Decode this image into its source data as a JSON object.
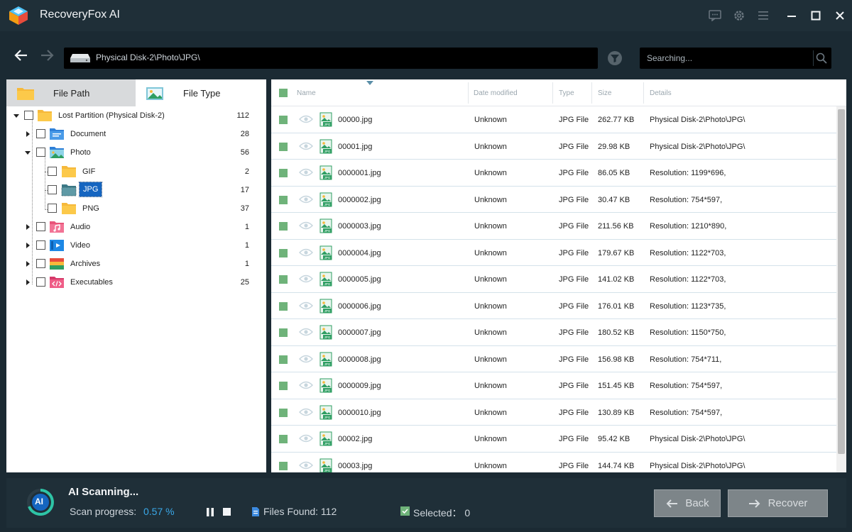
{
  "app": {
    "title": "RecoveryFox AI"
  },
  "nav": {
    "path": "Physical Disk-2\\Photo\\JPG\\",
    "search_placeholder": "Searching..."
  },
  "tabs": {
    "file_path": "File Path",
    "file_type": "File Type"
  },
  "tree": [
    {
      "label": "Lost Partition (Physical Disk-2)",
      "count": "112"
    },
    {
      "label": "Document",
      "count": "28"
    },
    {
      "label": "Photo",
      "count": "56"
    },
    {
      "label": "GIF",
      "count": "2"
    },
    {
      "label": "JPG",
      "count": "17"
    },
    {
      "label": "PNG",
      "count": "37"
    },
    {
      "label": "Audio",
      "count": "1"
    },
    {
      "label": "Video",
      "count": "1"
    },
    {
      "label": "Archives",
      "count": "1"
    },
    {
      "label": "Executables",
      "count": "25"
    }
  ],
  "table": {
    "headers": {
      "name": "Name",
      "date": "Date modified",
      "type": "Type",
      "size": "Size",
      "details": "Details"
    },
    "rows": [
      {
        "name": "00000.jpg",
        "date": "Unknown",
        "type": "JPG File",
        "size": "262.77 KB",
        "details": "Physical Disk-2\\Photo\\JPG\\"
      },
      {
        "name": "00001.jpg",
        "date": "Unknown",
        "type": "JPG File",
        "size": "29.98 KB",
        "details": "Physical Disk-2\\Photo\\JPG\\"
      },
      {
        "name": "0000001.jpg",
        "date": "Unknown",
        "type": "JPG File",
        "size": "86.05 KB",
        "details": "Resolution: 1199*696,"
      },
      {
        "name": "0000002.jpg",
        "date": "Unknown",
        "type": "JPG File",
        "size": "30.47 KB",
        "details": "Resolution: 754*597,"
      },
      {
        "name": "0000003.jpg",
        "date": "Unknown",
        "type": "JPG File",
        "size": "211.56 KB",
        "details": "Resolution: 1210*890,"
      },
      {
        "name": "0000004.jpg",
        "date": "Unknown",
        "type": "JPG File",
        "size": "179.67 KB",
        "details": "Resolution: 1122*703,"
      },
      {
        "name": "0000005.jpg",
        "date": "Unknown",
        "type": "JPG File",
        "size": "141.02 KB",
        "details": "Resolution: 1122*703,"
      },
      {
        "name": "0000006.jpg",
        "date": "Unknown",
        "type": "JPG File",
        "size": "176.01 KB",
        "details": "Resolution: 1123*735,"
      },
      {
        "name": "0000007.jpg",
        "date": "Unknown",
        "type": "JPG File",
        "size": "180.52 KB",
        "details": "Resolution: 1150*750,"
      },
      {
        "name": "0000008.jpg",
        "date": "Unknown",
        "type": "JPG File",
        "size": "156.98 KB",
        "details": "Resolution: 754*711,"
      },
      {
        "name": "0000009.jpg",
        "date": "Unknown",
        "type": "JPG File",
        "size": "151.45 KB",
        "details": "Resolution: 754*597,"
      },
      {
        "name": "0000010.jpg",
        "date": "Unknown",
        "type": "JPG File",
        "size": "130.89 KB",
        "details": "Resolution: 754*597,"
      },
      {
        "name": "00002.jpg",
        "date": "Unknown",
        "type": "JPG File",
        "size": "95.42 KB",
        "details": "Physical Disk-2\\Photo\\JPG\\"
      },
      {
        "name": "00003.jpg",
        "date": "Unknown",
        "type": "JPG File",
        "size": "144.74 KB",
        "details": "Physical Disk-2\\Photo\\JPG\\"
      }
    ]
  },
  "status": {
    "ai_badge": "AI",
    "title": "AI Scanning...",
    "progress_label": "Scan progress:",
    "progress_value": "0.57 %",
    "files_found": "Files Found: 112",
    "selected": "Selected： 0"
  },
  "buttons": {
    "back": "Back",
    "recover": "Recover"
  },
  "colors": {
    "accent": "#3aa8e8",
    "selected_blue": "#1565c0",
    "checkbox_green": "#6fb37a",
    "background": "#1b2a33"
  }
}
